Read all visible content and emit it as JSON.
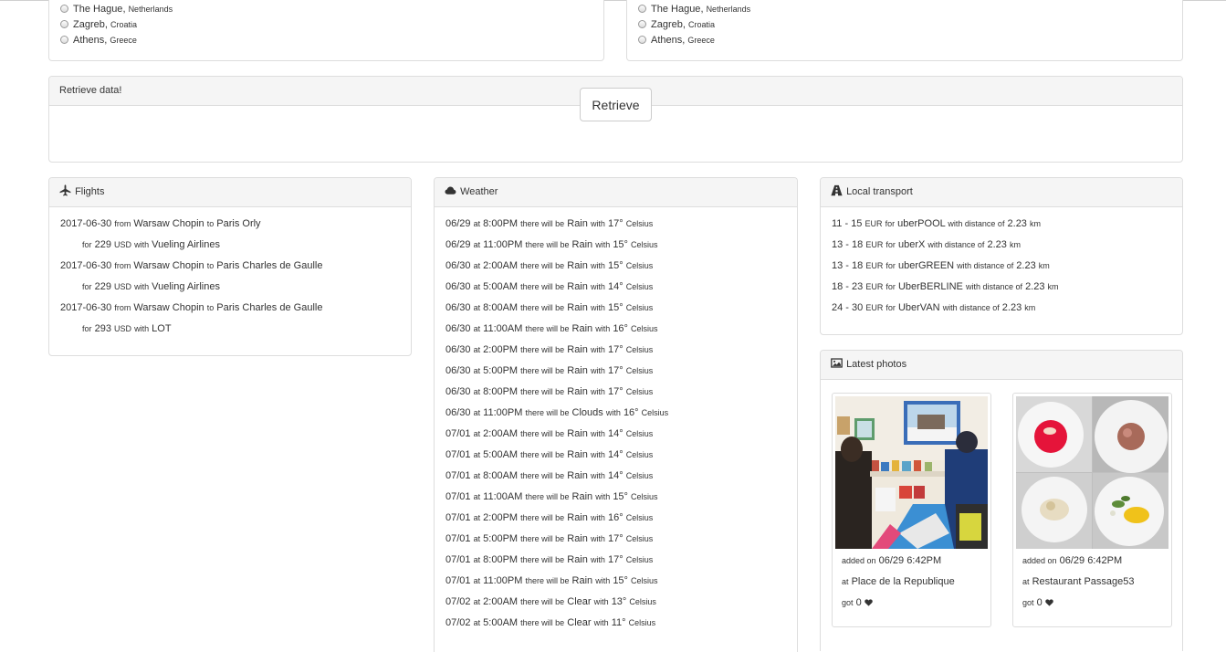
{
  "cities_left": [
    {
      "city": "The Hague",
      "country": "Netherlands"
    },
    {
      "city": "Zagreb",
      "country": "Croatia"
    },
    {
      "city": "Athens",
      "country": "Greece"
    }
  ],
  "cities_right": [
    {
      "city": "The Hague",
      "country": "Netherlands"
    },
    {
      "city": "Zagreb",
      "country": "Croatia"
    },
    {
      "city": "Athens",
      "country": "Greece"
    }
  ],
  "retrieve": {
    "heading": "Retrieve data!",
    "button": "Retrieve"
  },
  "words": {
    "from": "from",
    "to": "to",
    "for": "for",
    "with": "with",
    "at": "at",
    "there_will_be": "there will be",
    "celsius": "Celsius",
    "eur": "EUR",
    "with_distance_of": "with distance of",
    "km": "km",
    "added_on": "added on",
    "got": "got"
  },
  "flights": {
    "title": "Flights",
    "items": [
      {
        "date": "2017-06-30",
        "from": "Warsaw Chopin",
        "to": "Paris Orly",
        "price": "229",
        "currency": "USD",
        "airline": "Vueling Airlines"
      },
      {
        "date": "2017-06-30",
        "from": "Warsaw Chopin",
        "to": "Paris Charles de Gaulle",
        "price": "229",
        "currency": "USD",
        "airline": "Vueling Airlines"
      },
      {
        "date": "2017-06-30",
        "from": "Warsaw Chopin",
        "to": "Paris Charles de Gaulle",
        "price": "293",
        "currency": "USD",
        "airline": "LOT"
      }
    ]
  },
  "weather": {
    "title": "Weather",
    "items": [
      {
        "date": "06/29",
        "time": "8:00PM",
        "cond": "Rain",
        "temp": "17°"
      },
      {
        "date": "06/29",
        "time": "11:00PM",
        "cond": "Rain",
        "temp": "15°"
      },
      {
        "date": "06/30",
        "time": "2:00AM",
        "cond": "Rain",
        "temp": "15°"
      },
      {
        "date": "06/30",
        "time": "5:00AM",
        "cond": "Rain",
        "temp": "14°"
      },
      {
        "date": "06/30",
        "time": "8:00AM",
        "cond": "Rain",
        "temp": "15°"
      },
      {
        "date": "06/30",
        "time": "11:00AM",
        "cond": "Rain",
        "temp": "16°"
      },
      {
        "date": "06/30",
        "time": "2:00PM",
        "cond": "Rain",
        "temp": "17°"
      },
      {
        "date": "06/30",
        "time": "5:00PM",
        "cond": "Rain",
        "temp": "17°"
      },
      {
        "date": "06/30",
        "time": "8:00PM",
        "cond": "Rain",
        "temp": "17°"
      },
      {
        "date": "06/30",
        "time": "11:00PM",
        "cond": "Clouds",
        "temp": "16°"
      },
      {
        "date": "07/01",
        "time": "2:00AM",
        "cond": "Rain",
        "temp": "14°"
      },
      {
        "date": "07/01",
        "time": "5:00AM",
        "cond": "Rain",
        "temp": "14°"
      },
      {
        "date": "07/01",
        "time": "8:00AM",
        "cond": "Rain",
        "temp": "14°"
      },
      {
        "date": "07/01",
        "time": "11:00AM",
        "cond": "Rain",
        "temp": "15°"
      },
      {
        "date": "07/01",
        "time": "2:00PM",
        "cond": "Rain",
        "temp": "16°"
      },
      {
        "date": "07/01",
        "time": "5:00PM",
        "cond": "Rain",
        "temp": "17°"
      },
      {
        "date": "07/01",
        "time": "8:00PM",
        "cond": "Rain",
        "temp": "17°"
      },
      {
        "date": "07/01",
        "time": "11:00PM",
        "cond": "Rain",
        "temp": "15°"
      },
      {
        "date": "07/02",
        "time": "2:00AM",
        "cond": "Clear",
        "temp": "13°"
      },
      {
        "date": "07/02",
        "time": "5:00AM",
        "cond": "Clear",
        "temp": "11°"
      }
    ]
  },
  "transport": {
    "title": "Local transport",
    "items": [
      {
        "range": "11 - 15",
        "name": "uberPOOL",
        "distance": "2.23"
      },
      {
        "range": "13 - 18",
        "name": "uberX",
        "distance": "2.23"
      },
      {
        "range": "13 - 18",
        "name": "uberGREEN",
        "distance": "2.23"
      },
      {
        "range": "18 - 23",
        "name": "UberBERLINE",
        "distance": "2.23"
      },
      {
        "range": "24 - 30",
        "name": "UberVAN",
        "distance": "2.23"
      }
    ]
  },
  "photos": {
    "title": "Latest photos",
    "items": [
      {
        "added": "06/29 6:42PM",
        "place": "Place de la Republique",
        "likes": "0"
      },
      {
        "added": "06/29 6:42PM",
        "place": "Restaurant Passage53",
        "likes": "0"
      }
    ]
  }
}
